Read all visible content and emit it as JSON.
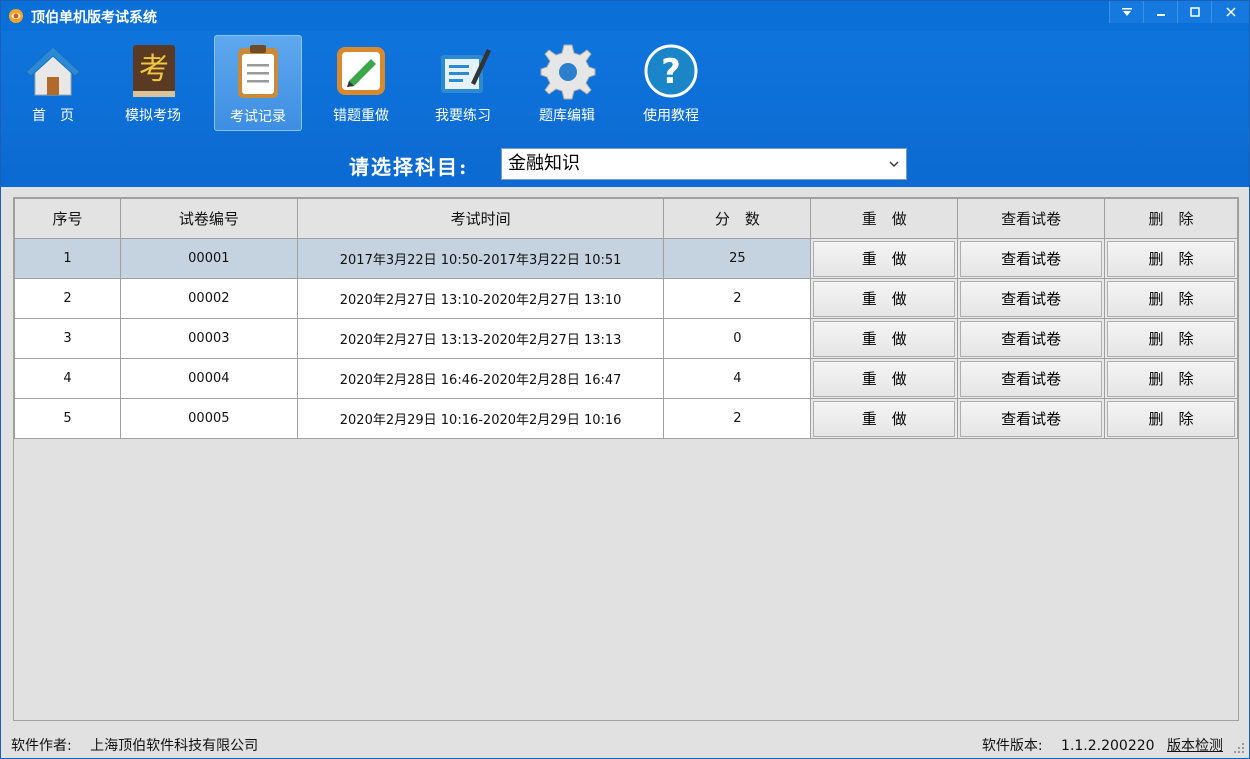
{
  "window": {
    "title": "顶伯单机版考试系统",
    "controls": [
      "menu-icon",
      "minimize-icon",
      "maximize-icon",
      "close-icon"
    ]
  },
  "toolbar": {
    "items": [
      {
        "label": "首　页",
        "icon": "home-icon"
      },
      {
        "label": "模拟考场",
        "icon": "exam-book-icon"
      },
      {
        "label": "考试记录",
        "icon": "clipboard-icon",
        "active": true
      },
      {
        "label": "错题重做",
        "icon": "edit-note-icon"
      },
      {
        "label": "我要练习",
        "icon": "practice-icon"
      },
      {
        "label": "题库编辑",
        "icon": "gear-icon"
      },
      {
        "label": "使用教程",
        "icon": "help-icon"
      }
    ]
  },
  "subject": {
    "label": "请选择科目:",
    "selected": "金融知识"
  },
  "table": {
    "headers": [
      "序号",
      "试卷编号",
      "考试时间",
      "分　数",
      "重　做",
      "查看试卷",
      "删　除"
    ],
    "rows": [
      {
        "index": "1",
        "paper_id": "00001",
        "time": "2017年3月22日 10:50-2017年3月22日 10:51",
        "score": "25",
        "redo": "重　做",
        "view": "查看试卷",
        "delete": "删　除",
        "selected": true
      },
      {
        "index": "2",
        "paper_id": "00002",
        "time": "2020年2月27日 13:10-2020年2月27日 13:10",
        "score": "2",
        "redo": "重　做",
        "view": "查看试卷",
        "delete": "删　除"
      },
      {
        "index": "3",
        "paper_id": "00003",
        "time": "2020年2月27日 13:13-2020年2月27日 13:13",
        "score": "0",
        "redo": "重　做",
        "view": "查看试卷",
        "delete": "删　除"
      },
      {
        "index": "4",
        "paper_id": "00004",
        "time": "2020年2月28日 16:46-2020年2月28日 16:47",
        "score": "4",
        "redo": "重　做",
        "view": "查看试卷",
        "delete": "删　除"
      },
      {
        "index": "5",
        "paper_id": "00005",
        "time": "2020年2月29日 10:16-2020年2月29日 10:16",
        "score": "2",
        "redo": "重　做",
        "view": "查看试卷",
        "delete": "删　除"
      }
    ]
  },
  "status": {
    "author_label": "软件作者:",
    "author": "上海顶伯软件科技有限公司",
    "version_label": "软件版本:",
    "version": "1.1.2.200220",
    "check_link": "版本检测"
  },
  "colors": {
    "titlebar": "#0a6fd6",
    "toolbar": "#0e74dc",
    "selected_row": "#c5d3e0"
  }
}
